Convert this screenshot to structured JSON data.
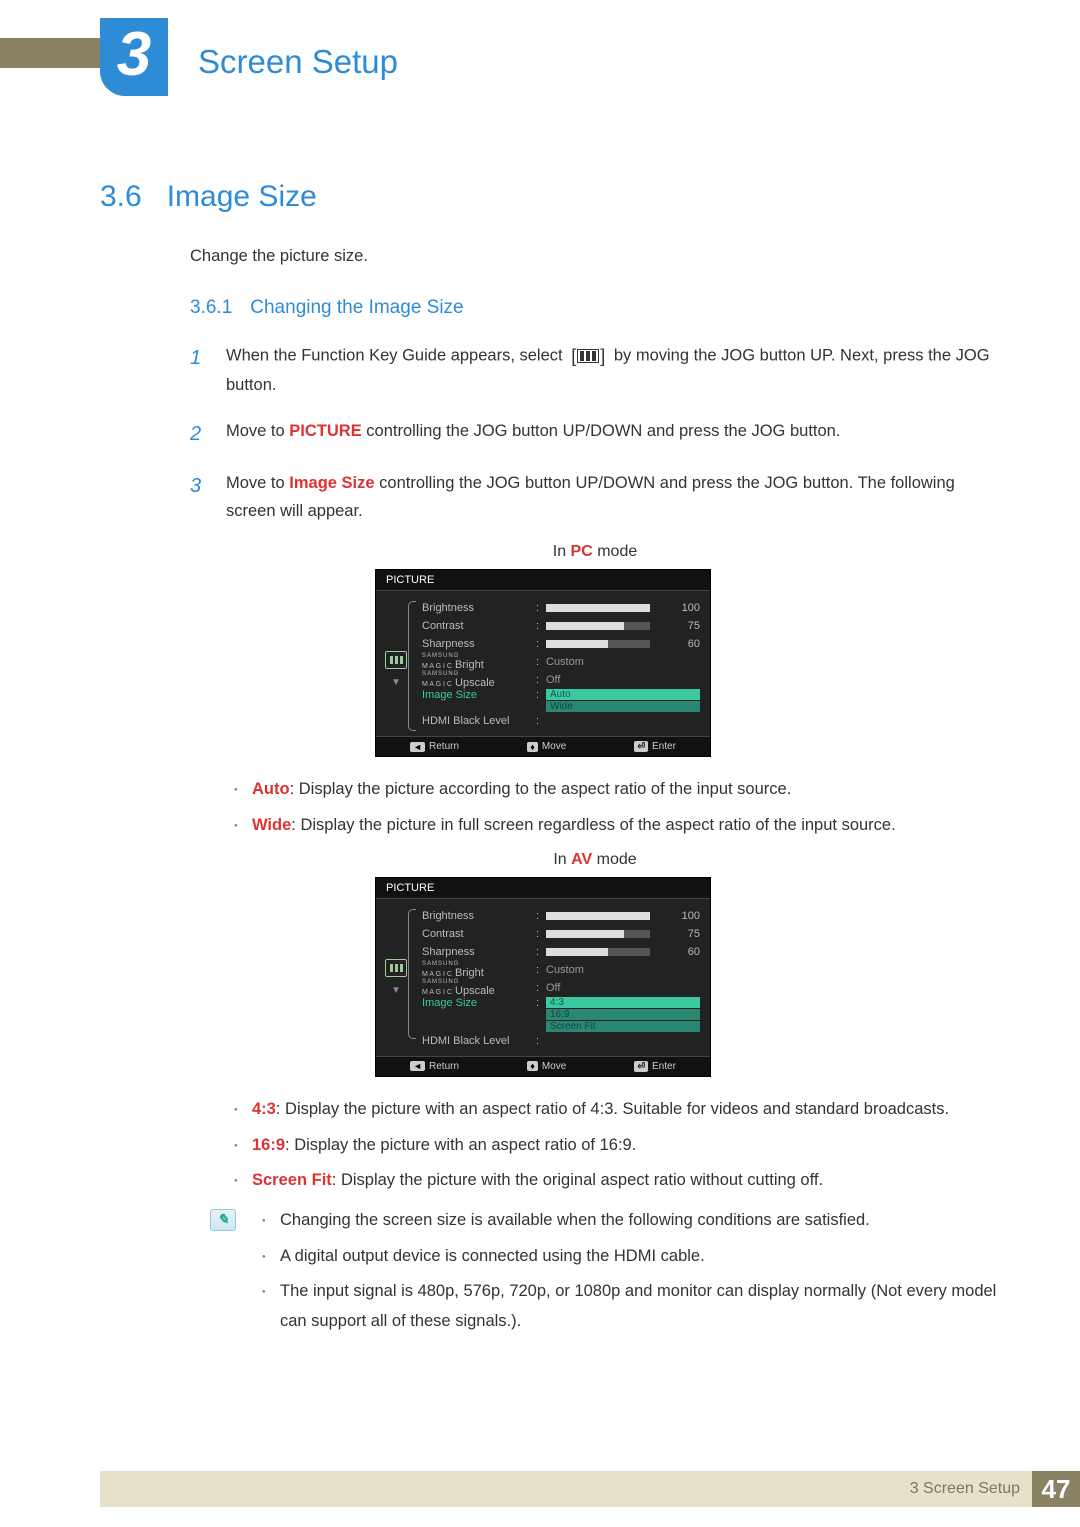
{
  "chapter": {
    "number": "3",
    "title": "Screen Setup"
  },
  "section": {
    "number": "3.6",
    "title": "Image Size",
    "intro": "Change the picture size."
  },
  "subsection": {
    "number": "3.6.1",
    "title": "Changing the Image Size"
  },
  "steps": {
    "s1a": "When the Function Key Guide appears, select",
    "s1b": "by moving the JOG button UP. Next, press the JOG button.",
    "s2a": "Move to ",
    "s2_hl": "PICTURE",
    "s2b": " controlling the JOG button UP/DOWN and press the JOG button.",
    "s3a": "Move to ",
    "s3_hl": "Image Size",
    "s3b": " controlling the JOG button UP/DOWN and press the JOG button. The following screen will appear."
  },
  "mode_pc_pre": "In ",
  "mode_pc_hl": "PC",
  "mode_pc_post": " mode",
  "mode_av_pre": "In ",
  "mode_av_hl": "AV",
  "mode_av_post": " mode",
  "osd": {
    "title": "PICTURE",
    "rows": {
      "brightness": "Brightness",
      "contrast": "Contrast",
      "sharpness": "Sharpness",
      "magic_bright_s": "SAMSUNG",
      "magic_bright_m": "M A G I C",
      "magic_bright_suf": " Bright",
      "magic_upscale_suf": " Upscale",
      "image_size": "Image Size",
      "hdmi_black": "HDMI Black Level"
    },
    "vals": {
      "brightness": "100",
      "contrast": "75",
      "sharpness": "60",
      "custom": "Custom",
      "off": "Off"
    },
    "pc_opts": {
      "o1": "Auto",
      "o2": "Wide"
    },
    "av_opts": {
      "o1": "4:3",
      "o2": "16:9",
      "o3": "Screen Fit"
    },
    "foot": {
      "return": "Return",
      "move": "Move",
      "enter": "Enter"
    }
  },
  "pc_bullets": {
    "b1_hl": "Auto",
    "b1": ": Display the picture according to the aspect ratio of the input source.",
    "b2_hl": "Wide",
    "b2": ": Display the picture in full screen regardless of the aspect ratio of the input source."
  },
  "av_bullets": {
    "b1_hl": "4:3",
    "b1": ": Display the picture with an aspect ratio of 4:3. Suitable for videos and standard broadcasts.",
    "b2_hl": "16:9",
    "b2": ": Display the picture with an aspect ratio of 16:9.",
    "b3_hl": "Screen Fit",
    "b3": ": Display the picture with the original aspect ratio without cutting off."
  },
  "notes": {
    "n1": "Changing the screen size is available when the following conditions are satisfied.",
    "n2": "A digital output device is connected using the HDMI cable.",
    "n3": "The input signal is 480p, 576p, 720p, or 1080p and monitor can display normally (Not every model can support all of these signals.)."
  },
  "footer": {
    "crumb": "3 Screen Setup",
    "page": "47"
  }
}
